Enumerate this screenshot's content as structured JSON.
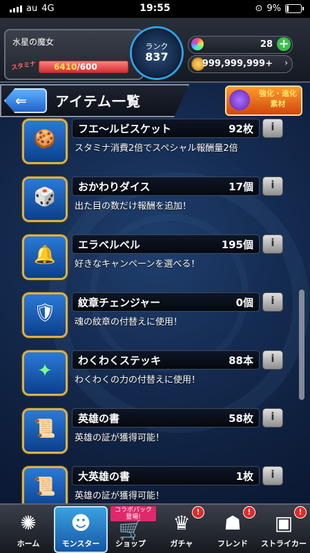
{
  "status_bar": {
    "carrier": "au",
    "network": "4G",
    "time": "19:55",
    "battery_percent": "9%"
  },
  "header": {
    "player_name": "水星の魔女",
    "stamina_label": "スタミナ",
    "stamina_current": "6410",
    "stamina_max": "/600",
    "stamina_fraction": 1.0,
    "rank_label": "ランク",
    "rank_value": "837",
    "orbs": "28",
    "coins": "999,999,999+",
    "more": "›"
  },
  "title_bar": {
    "back_arrow": "⇐",
    "title": "アイテム一覧",
    "evolve_line1": "強化・進化",
    "evolve_line2": "素材"
  },
  "items": [
    {
      "name": "フエ〜ルビスケット",
      "count": "92枚",
      "desc": "スタミナ消費2倍でスペシャル報酬量2倍",
      "icon": "biscuit-icon",
      "glyph": "🍪"
    },
    {
      "name": "おかわりダイス",
      "count": "17個",
      "desc": "出た目の数だけ報酬を追加！",
      "icon": "dice-icon",
      "glyph": "🎲"
    },
    {
      "name": "エラベルベル",
      "count": "195個",
      "desc": "好きなキャンペーンを選べる！",
      "icon": "bell-icon",
      "glyph": "🔔"
    },
    {
      "name": "紋章チェンジャー",
      "count": "0個",
      "desc": "魂の紋章の付替えに使用！",
      "icon": "emblem-changer-icon",
      "glyph": "🛡"
    },
    {
      "name": "わくわくステッキ",
      "count": "88本",
      "desc": "わくわくの力の付替えに使用！",
      "icon": "wand-icon",
      "glyph": "✦"
    },
    {
      "name": "英雄の書",
      "count": "58枚",
      "desc": "英雄の証が獲得可能！",
      "icon": "hero-book-icon",
      "glyph": "📜"
    },
    {
      "name": "大英雄の書",
      "count": "1枚",
      "desc": "英雄の証が獲得可能！",
      "icon": "great-hero-book-icon",
      "glyph": "📜"
    }
  ],
  "info_glyph": "i",
  "nav": {
    "home": "ホーム",
    "monster": "モンスター",
    "shop": "ショップ",
    "gacha": "ガチャ",
    "friend": "フレンド",
    "striker": "ストライカー",
    "collab": "コラボパック 登場!",
    "badge": "!"
  }
}
